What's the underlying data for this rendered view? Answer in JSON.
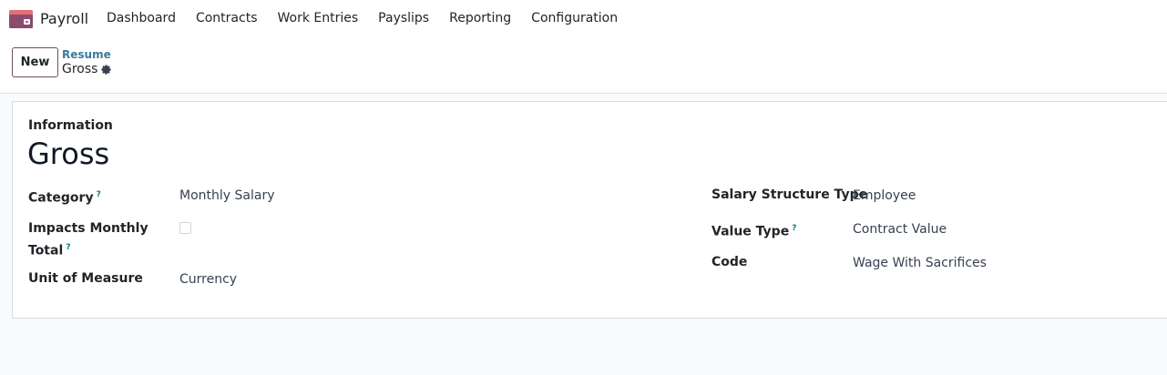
{
  "navbar": {
    "app_name": "Payroll",
    "menu": [
      "Dashboard",
      "Contracts",
      "Work Entries",
      "Payslips",
      "Reporting",
      "Configuration"
    ]
  },
  "control_panel": {
    "new_label": "New",
    "breadcrumb_parent": "Resume",
    "breadcrumb_current": "Gross"
  },
  "form": {
    "section_label": "Information",
    "title": "Gross",
    "left": {
      "category_label": "Category",
      "category_value": "Monthly Salary",
      "impacts_label_line1": "Impacts Monthly",
      "impacts_label_line2": "Total",
      "unit_label": "Unit of Measure",
      "unit_value": "Currency"
    },
    "right": {
      "structure_type_label": "Salary Structure Type",
      "structure_type_value": "Employee",
      "value_type_label": "Value Type",
      "value_type_value": "Contract Value",
      "code_label": "Code",
      "code_value": "Wage With Sacrifices"
    },
    "help_mark": "?"
  },
  "colors": {
    "brand": "#714b67",
    "link": "#3b7a9e",
    "help": "#017e84"
  }
}
